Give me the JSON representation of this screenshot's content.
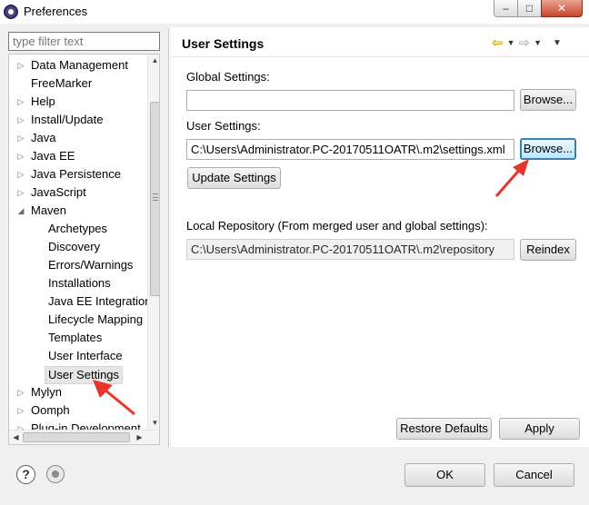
{
  "window": {
    "title": "Preferences"
  },
  "window_controls": {
    "minimize": "–",
    "maximize": "□",
    "close": "✕"
  },
  "filter": {
    "placeholder": "type filter text"
  },
  "tree": {
    "items": [
      {
        "label": "Data Management",
        "arrow": "▷"
      },
      {
        "label": "FreeMarker",
        "arrow": ""
      },
      {
        "label": "Help",
        "arrow": "▷"
      },
      {
        "label": "Install/Update",
        "arrow": "▷"
      },
      {
        "label": "Java",
        "arrow": "▷"
      },
      {
        "label": "Java EE",
        "arrow": "▷"
      },
      {
        "label": "Java Persistence",
        "arrow": "▷"
      },
      {
        "label": "JavaScript",
        "arrow": "▷"
      },
      {
        "label": "Maven",
        "arrow": "◢"
      },
      {
        "label": "Archetypes",
        "arrow": ""
      },
      {
        "label": "Discovery",
        "arrow": ""
      },
      {
        "label": "Errors/Warnings",
        "arrow": ""
      },
      {
        "label": "Installations",
        "arrow": ""
      },
      {
        "label": "Java EE Integration",
        "arrow": ""
      },
      {
        "label": "Lifecycle Mapping",
        "arrow": ""
      },
      {
        "label": "Templates",
        "arrow": ""
      },
      {
        "label": "User Interface",
        "arrow": ""
      },
      {
        "label": "User Settings",
        "arrow": ""
      },
      {
        "label": "Mylyn",
        "arrow": "▷"
      },
      {
        "label": "Oomph",
        "arrow": "▷"
      },
      {
        "label": "Plug-in Development",
        "arrow": "▷"
      }
    ]
  },
  "page": {
    "title": "User Settings",
    "global_settings_label": "Global Settings:",
    "global_settings_value": "",
    "user_settings_label": "User Settings:",
    "user_settings_value": "C:\\Users\\Administrator.PC-20170511OATR\\.m2\\settings.xml",
    "browse_label": "Browse...",
    "update_settings_label": "Update Settings",
    "local_repo_label": "Local Repository (From merged user and global settings):",
    "local_repo_value": "C:\\Users\\Administrator.PC-20170511OATR\\.m2\\repository",
    "reindex_label": "Reindex",
    "restore_defaults_label": "Restore Defaults",
    "apply_label": "Apply"
  },
  "nav": {
    "back_icon": "⇦",
    "forward_icon": "⇨",
    "dropdown": "▼",
    "menu": "▼"
  },
  "bottom": {
    "help_icon": "?",
    "ok_label": "OK",
    "cancel_label": "Cancel"
  },
  "colors": {
    "annotation_arrow": "#e8362a",
    "focus_border": "#3c7fb1"
  }
}
